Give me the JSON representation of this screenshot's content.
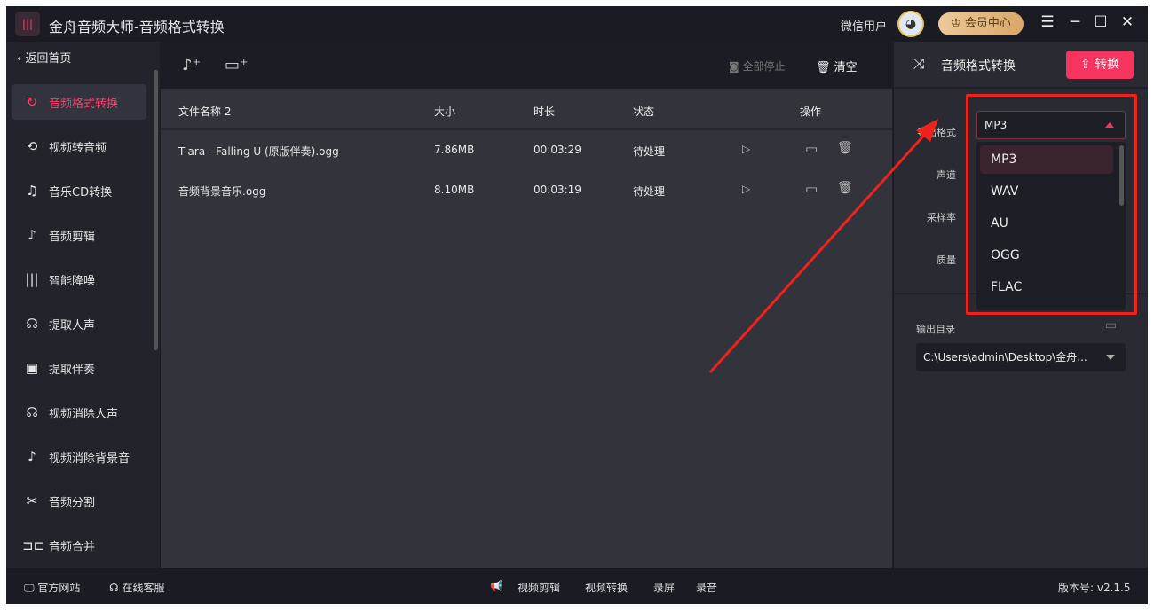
{
  "app": {
    "title": "金舟音频大师-音频格式转换",
    "user": "微信用户",
    "vip": "会员中心"
  },
  "sidebar": {
    "back": "返回首页",
    "items": [
      {
        "label": "音频格式转换",
        "icon": "↻"
      },
      {
        "label": "视频转音频",
        "icon": "⟲"
      },
      {
        "label": "音乐CD转换",
        "icon": "♫"
      },
      {
        "label": "音频剪辑",
        "icon": "♪"
      },
      {
        "label": "智能降噪",
        "icon": "|||"
      },
      {
        "label": "提取人声",
        "icon": "☊"
      },
      {
        "label": "提取伴奏",
        "icon": "▣"
      },
      {
        "label": "视频消除人声",
        "icon": "☊"
      },
      {
        "label": "视频消除背景音",
        "icon": "♪"
      },
      {
        "label": "音频分割",
        "icon": "✂"
      },
      {
        "label": "音频合并",
        "icon": "⊐⊏"
      }
    ]
  },
  "toolbar": {
    "stop_all": "全部停止",
    "clear": "清空"
  },
  "table": {
    "headers": [
      "文件名称 2",
      "大小",
      "时长",
      "状态",
      "操作"
    ],
    "rows": [
      {
        "name": "T-ara - Falling U (原版伴奏).ogg",
        "size": "7.86MB",
        "duration": "00:03:29",
        "status": "待处理"
      },
      {
        "name": "音频背景音乐.ogg",
        "size": "8.10MB",
        "duration": "00:03:19",
        "status": "待处理"
      }
    ]
  },
  "panel": {
    "title": "音频格式转换",
    "convert": "转换",
    "labels": {
      "format": "导出格式",
      "channel": "声道",
      "sample_rate": "采样率",
      "quality": "质量",
      "output_dir": "输出目录"
    },
    "format_value": "MP3",
    "format_options": [
      "MP3",
      "WAV",
      "AU",
      "OGG",
      "FLAC"
    ],
    "output_path": "C:\\Users\\admin\\Desktop\\金舟..."
  },
  "footer": {
    "website": "官方网站",
    "service": "在线客服",
    "links": [
      "视频剪辑",
      "视频转换",
      "录屏",
      "录音"
    ],
    "version": "版本号: v2.1.5"
  },
  "colors": {
    "accent": "#f5355f",
    "annotation": "#f0221c"
  }
}
